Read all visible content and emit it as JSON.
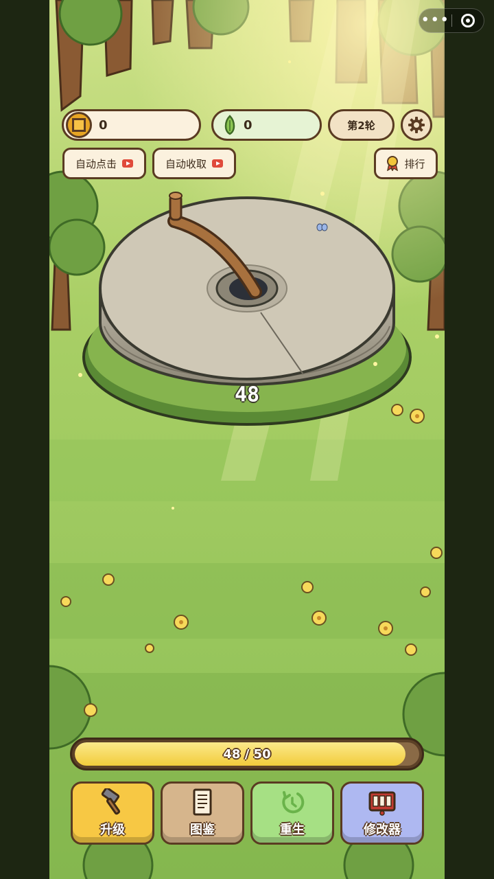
{
  "capsule": {
    "more_icon": "more-dots-icon",
    "close_icon": "target-icon"
  },
  "resources": {
    "coins": {
      "icon": "coin-icon",
      "value": "0"
    },
    "seeds": {
      "icon": "seed-icon",
      "value": "0"
    }
  },
  "round_label": "第2轮",
  "settings_icon": "gear-icon",
  "buttons": {
    "auto_click": "自动点击",
    "auto_collect": "自动收取",
    "rank": "排行"
  },
  "millstone": {
    "count": "48"
  },
  "progress": {
    "label": "48 / 50",
    "current": 48,
    "max": 50
  },
  "actions": {
    "upgrade": "升级",
    "codex": "图鉴",
    "rebirth": "重生",
    "modifier": "修改器"
  },
  "colors": {
    "grass": "#8fbf55",
    "border": "#5a3b22",
    "upgrade": "#f7c844",
    "codex": "#d6b58c",
    "rebirth": "#a6e084",
    "modifier": "#aeb8f1"
  }
}
